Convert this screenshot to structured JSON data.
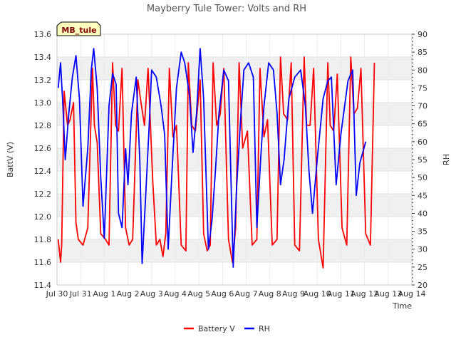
{
  "chart_data": {
    "type": "line",
    "title": "Mayberry Tule Tower: Volts and RH",
    "xlabel": "Time",
    "ylabel": "BattV (V)",
    "y2label": "RH",
    "ylim": [
      11.4,
      13.6
    ],
    "y2lim": [
      20,
      90
    ],
    "x_ticks": [
      "Jul 30",
      "Jul 31",
      "Aug 1",
      "Aug 2",
      "Aug 3",
      "Aug 4",
      "Aug 5",
      "Aug 6",
      "Aug 7",
      "Aug 8",
      "Aug 9",
      "Aug 10",
      "Aug 11",
      "Aug 12",
      "Aug 13",
      "Aug 14"
    ],
    "y_ticks": [
      "11.4",
      "11.6",
      "11.8",
      "12.0",
      "12.2",
      "12.4",
      "12.6",
      "12.8",
      "13.0",
      "13.2",
      "13.4",
      "13.6"
    ],
    "y2_ticks": [
      "20",
      "25",
      "30",
      "35",
      "40",
      "45",
      "50",
      "55",
      "60",
      "65",
      "70",
      "75",
      "80",
      "85",
      "90"
    ],
    "grid": true,
    "legend_position": "bottom-center",
    "annotation": "MB_tule",
    "colors": {
      "battery": "#ff0000",
      "rh": "#0000ff",
      "band": "#f0f0f0",
      "annotation_bg": "#ffffc0",
      "annotation_text": "#800000"
    },
    "series": [
      {
        "name": "Battery V",
        "axis": "left",
        "x": [
          0.05,
          0.15,
          0.2,
          0.3,
          0.45,
          0.55,
          0.7,
          0.8,
          0.9,
          1.1,
          1.3,
          1.5,
          1.58,
          1.7,
          1.85,
          2.05,
          2.2,
          2.35,
          2.48,
          2.6,
          2.75,
          2.9,
          3.05,
          3.2,
          3.42,
          3.55,
          3.7,
          3.85,
          4.05,
          4.2,
          4.35,
          4.48,
          4.6,
          4.75,
          4.9,
          5.05,
          5.25,
          5.45,
          5.55,
          5.7,
          5.85,
          6.05,
          6.2,
          6.35,
          6.48,
          6.6,
          6.75,
          6.9,
          7.05,
          7.25,
          7.42,
          7.55,
          7.7,
          7.85,
          8.05,
          8.25,
          8.45,
          8.58,
          8.75,
          8.9,
          9.1,
          9.3,
          9.45,
          9.58,
          9.75,
          9.9,
          10.05,
          10.25,
          10.45,
          10.55,
          10.7,
          10.85,
          11.05,
          11.25,
          11.45,
          11.55,
          11.7,
          11.85,
          12.05,
          12.25,
          12.42,
          12.55,
          12.7,
          12.85,
          13.05,
          13.25,
          13.42
        ],
        "values": [
          11.8,
          11.6,
          11.75,
          13.1,
          12.8,
          12.85,
          13.0,
          11.95,
          11.8,
          11.75,
          11.9,
          13.3,
          12.8,
          12.65,
          11.85,
          11.8,
          11.75,
          13.35,
          12.8,
          12.75,
          13.3,
          11.9,
          11.75,
          11.8,
          13.2,
          13.0,
          12.8,
          13.3,
          12.3,
          11.75,
          11.8,
          11.65,
          11.85,
          13.3,
          12.7,
          12.8,
          11.75,
          11.7,
          13.35,
          12.8,
          12.75,
          13.2,
          11.85,
          11.7,
          11.75,
          13.35,
          12.8,
          12.9,
          13.3,
          11.8,
          11.6,
          11.9,
          13.35,
          12.6,
          12.75,
          11.75,
          11.8,
          13.3,
          12.7,
          12.85,
          11.75,
          11.8,
          13.4,
          12.9,
          12.85,
          13.35,
          11.75,
          11.7,
          13.4,
          12.8,
          12.8,
          13.3,
          11.8,
          11.55,
          13.35,
          12.8,
          12.75,
          13.25,
          11.9,
          11.75,
          13.4,
          12.9,
          12.95,
          13.3,
          11.85,
          11.75,
          13.35
        ]
      },
      {
        "name": "RH",
        "axis": "right",
        "x": [
          0.05,
          0.15,
          0.25,
          0.35,
          0.5,
          0.65,
          0.8,
          0.95,
          1.1,
          1.3,
          1.45,
          1.55,
          1.7,
          1.85,
          2.0,
          2.2,
          2.35,
          2.5,
          2.6,
          2.75,
          2.9,
          3.0,
          3.15,
          3.35,
          3.5,
          3.6,
          3.75,
          3.9,
          4.0,
          4.2,
          4.4,
          4.55,
          4.7,
          4.85,
          5.05,
          5.25,
          5.4,
          5.6,
          5.75,
          5.9,
          6.05,
          6.2,
          6.4,
          6.55,
          6.7,
          6.85,
          7.05,
          7.25,
          7.45,
          7.6,
          7.75,
          7.9,
          8.1,
          8.3,
          8.45,
          8.6,
          8.75,
          8.95,
          9.15,
          9.3,
          9.45,
          9.6,
          9.8,
          10.05,
          10.3,
          10.5,
          10.65,
          10.8,
          11.0,
          11.25,
          11.45,
          11.6,
          11.8,
          12.0,
          12.3,
          12.5,
          12.65,
          12.8,
          13.05
        ],
        "values": [
          75,
          82,
          70,
          55,
          68,
          78,
          84,
          72,
          42,
          58,
          80,
          86,
          75,
          50,
          33,
          70,
          79,
          76,
          40,
          36,
          58,
          48,
          68,
          78,
          55,
          26,
          45,
          65,
          80,
          78,
          70,
          62,
          30,
          50,
          75,
          85,
          82,
          73,
          57,
          68,
          86,
          72,
          30,
          38,
          52,
          68,
          80,
          77,
          25,
          48,
          65,
          80,
          82,
          78,
          36,
          54,
          70,
          82,
          80,
          68,
          48,
          55,
          72,
          78,
          80,
          70,
          52,
          40,
          55,
          72,
          77,
          78,
          48,
          62,
          77,
          80,
          45,
          54,
          60
        ]
      }
    ]
  }
}
